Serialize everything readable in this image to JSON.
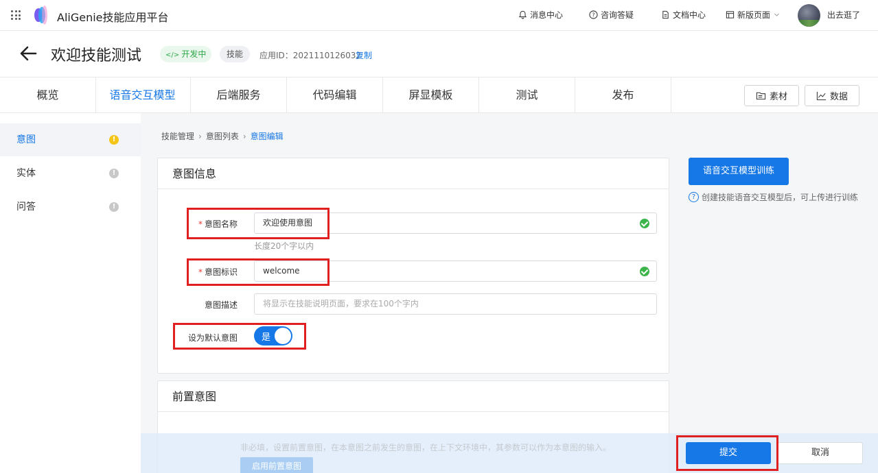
{
  "app": {
    "title": "AliGenie技能应用平台"
  },
  "top_nav": {
    "messages": "消息中心",
    "consult": "咨询答疑",
    "docs": "文档中心",
    "new_page": "新版页面",
    "username": "出去逛了"
  },
  "skill": {
    "title": "欢迎技能测试",
    "status": "开发中",
    "type": "技能",
    "app_id_label": "应用ID：",
    "app_id": "2021110126032",
    "copy": "复制"
  },
  "tabs": [
    "概览",
    "语音交互模型",
    "后端服务",
    "代码编辑",
    "屏显模板",
    "测试",
    "发布"
  ],
  "active_tab": "语音交互模型",
  "toolbar": {
    "materials": "素材",
    "data": "数据"
  },
  "sidebar": {
    "items": [
      {
        "label": "意图",
        "status": "warning"
      },
      {
        "label": "实体",
        "status": "info"
      },
      {
        "label": "问答",
        "status": "info"
      }
    ]
  },
  "breadcrumb": [
    "技能管理",
    "意图列表",
    "意图编辑"
  ],
  "intent_info": {
    "title": "意图信息",
    "name_label": "意图名称",
    "name_value": "欢迎使用意图",
    "name_hint": "长度20个字以内",
    "id_label": "意图标识",
    "id_value": "welcome",
    "desc_label": "意图描述",
    "desc_placeholder": "将显示在技能说明页面，要求在100个字内",
    "default_label": "设为默认意图",
    "default_value": "是",
    "default_on": true
  },
  "pre_intent": {
    "title": "前置意图",
    "hint": "非必填，设置前置意图，在本意图之前发生的意图，在上下文环境中，其参数可以作为本意图的输入。",
    "enable_button": "启用前置意图"
  },
  "train": {
    "button": "语音交互模型训练",
    "tip": "创建技能语音交互模型后，可上传进行训练"
  },
  "actions": {
    "submit": "提交",
    "cancel": "取消"
  },
  "colors": {
    "primary": "#1677e6",
    "highlight": "#e02020",
    "success": "#3bb44a",
    "warning": "#f5c518"
  }
}
